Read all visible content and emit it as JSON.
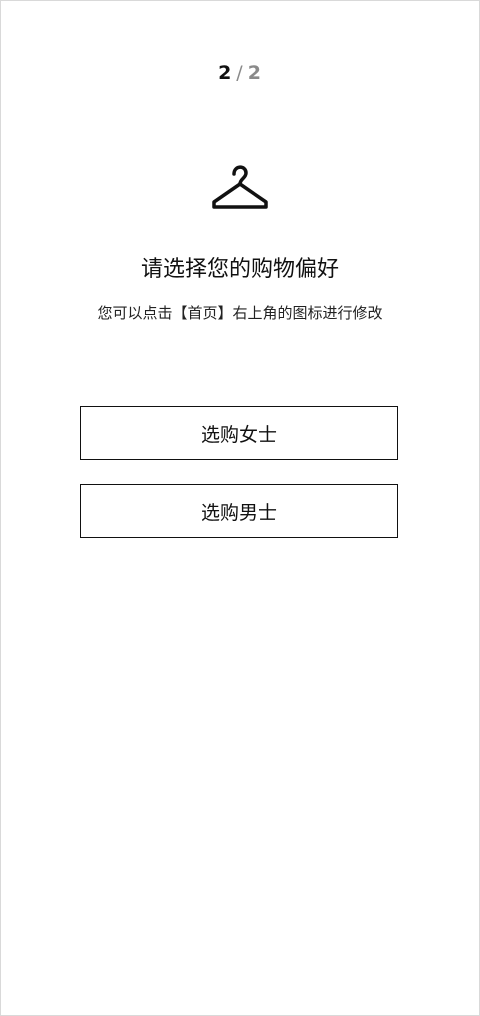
{
  "pager": {
    "current": "2",
    "separator": "/",
    "total": "2"
  },
  "icon": "hanger-icon",
  "title": "请选择您的购物偏好",
  "subtitle": "您可以点击【首页】右上角的图标进行修改",
  "options": {
    "women": "选购女士",
    "men": "选购男士"
  }
}
